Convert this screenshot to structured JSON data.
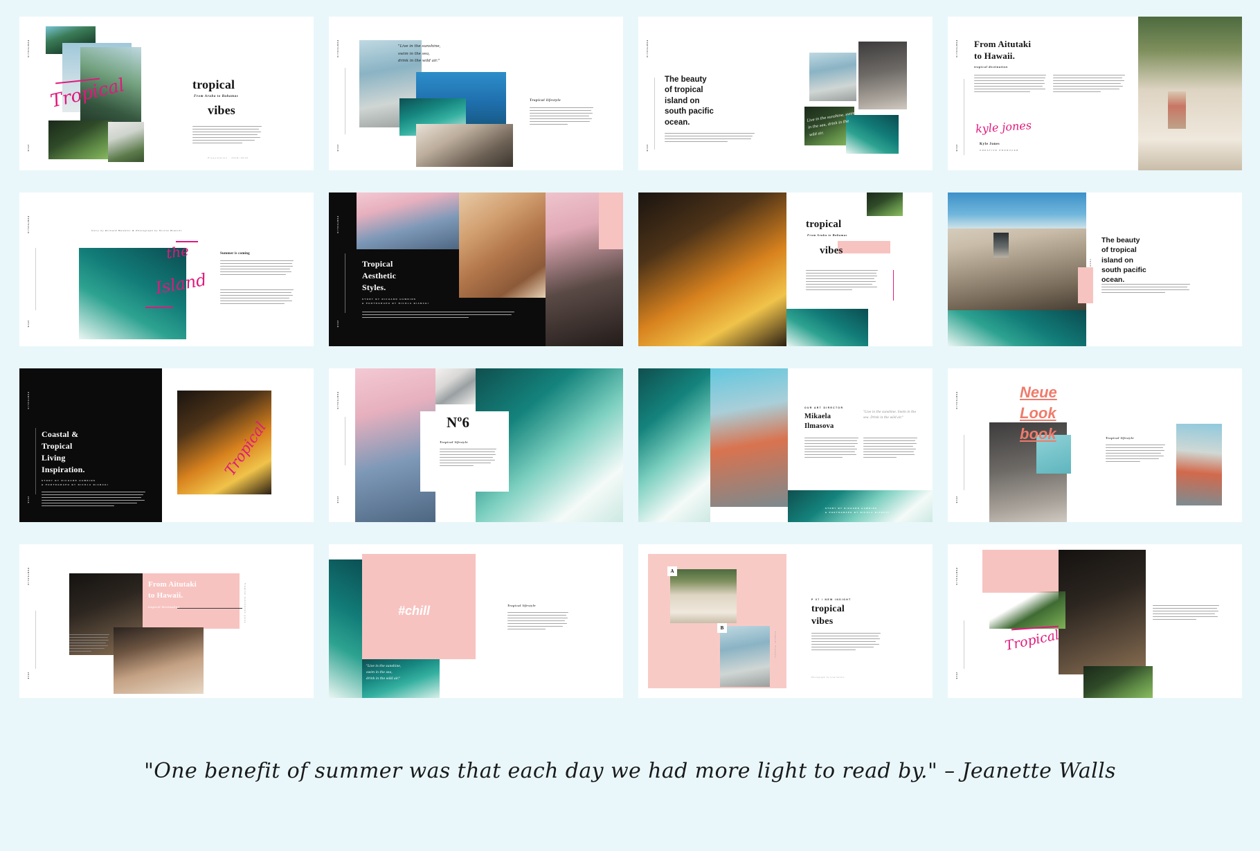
{
  "page": {
    "background_color": "#e9f7fb",
    "accent_pink": "#e0197c",
    "blush": "#f7c3c0",
    "coral": "#ef7b6b",
    "quote": "\"One benefit of summer was that each day we had more light to read by.\" – Jeanette Walls"
  },
  "common": {
    "vlabel_top": "PORTFOLIO",
    "vlabel_bottom": "2018",
    "tropical_lifestyle": "Tropical lifestyle",
    "story_credit": "STORY BY RICHARD HAWKINS",
    "photo_credit": "& PHOTOGRAPH BY NICOLA BIANCHI",
    "story_photo_line": "Story by Richard Hawkins & Photograph by Nicola Bianchi",
    "live_quote_l1": "\"Live in the sunshine,",
    "live_quote_l2": "swim in the sea,",
    "live_quote_l3": "drink in the wild air.\"",
    "live_quote_inline": "\"Live in the sunshine. Swim in the sea. Drink in the wild air.\""
  },
  "slides": [
    {
      "id": "slide-01",
      "name": "cover-tropical-vibes",
      "title_line1": "tropical",
      "subtitle": "From Aruba to Bahamas",
      "title_line2": "vibes",
      "script_word": "Tropical",
      "footer": "Presentation · 2018–2019"
    },
    {
      "id": "slide-02",
      "name": "photo-collage-quote",
      "quote_l1": "\"Live in the sunshine,",
      "quote_l2": "swim in the sea,",
      "quote_l3": "drink in the wild air.\"",
      "side_heading": "Tropical lifestyle"
    },
    {
      "id": "slide-03",
      "name": "beauty-of-tropical-island",
      "heading": "The beauty\nof tropical\nisland on\nsouth pacific\nocean.",
      "script_quote": "Live in the sunshine, swim in the sea, drink in the wild air."
    },
    {
      "id": "slide-04",
      "name": "from-aitutaki-to-hawaii",
      "heading_l1": "From Aitutaki",
      "heading_l2": "to Hawaii.",
      "subtitle": "tropical destination",
      "signature_script": "kyle jones",
      "signature_name": "Kyle Jones",
      "signature_role": "CREATIVE PRODUCER"
    },
    {
      "id": "slide-05",
      "name": "the-island-article",
      "credit": "Story by Richard Hawkins & Photograph by Nicola Bianchi",
      "script_l1": "the",
      "script_l2": "Island",
      "body_heading": "Summer is coming"
    },
    {
      "id": "slide-06",
      "name": "tropical-aesthetic-styles",
      "heading_l1": "Tropical",
      "heading_l2": "Aesthetic",
      "heading_l3": "Styles.",
      "credit_l1": "STORY BY RICHARD HAWKINS",
      "credit_l2": "& PHOTOGRAPH BY NICOLA BIANCHI"
    },
    {
      "id": "slide-07",
      "name": "tropical-vibes-pink-block",
      "title_line1": "tropical",
      "subtitle": "From Aruba to Bahamas",
      "title_line2": "vibes"
    },
    {
      "id": "slide-08",
      "name": "beauty-of-tropical-island-b",
      "heading": "The beauty\nof tropical\nisland on\nsouth pacific\nocean."
    },
    {
      "id": "slide-09",
      "name": "coastal-tropical-living",
      "heading_l1": "Coastal &",
      "heading_l2": "Tropical",
      "heading_l3": "Living",
      "heading_l4": "Inspiration.",
      "credit_l1": "STORY BY RICHARD HAWKINS",
      "credit_l2": "& PHOTOGRAPH BY NICOLA BIANCHI",
      "script_word": "Tropical"
    },
    {
      "id": "slide-10",
      "name": "number-six-editorial",
      "number": "Nº6",
      "side_heading": "Tropical lifestyle"
    },
    {
      "id": "slide-11",
      "name": "art-director-profile",
      "kicker": "OUR ART DIRECTOR",
      "name_l1": "Mikaela",
      "name_l2": "Ilmasova",
      "quote": "\"Live in the sunshine. Swim in the sea. Drink in the wild air.\"",
      "credit_l1": "STORY BY RICHARD HAWKINS",
      "credit_l2": "& PHOTOGRAPH BY NICOLA BIANCHI"
    },
    {
      "id": "slide-12",
      "name": "neue-look-book",
      "title_l1": "Neue",
      "title_l2": "Look",
      "title_l3": "book",
      "side_heading": "Tropical lifestyle"
    },
    {
      "id": "slide-13",
      "name": "from-aitutaki-pink-panel",
      "heading_l1": "From Aitutaki",
      "heading_l2": "to Hawaii.",
      "subtitle": "tropical destination",
      "side_note": "Tropical destination guide"
    },
    {
      "id": "slide-14",
      "name": "chill-pink-panel",
      "hashtag": "#chill",
      "quote_l1": "\"Live in the sunshine,",
      "quote_l2": "swim in the sea,",
      "quote_l3": "drink in the wild air.\"",
      "side_heading": "Tropical lifestyle"
    },
    {
      "id": "slide-15",
      "name": "ab-compare-tropical-vibes",
      "badge_a": "A",
      "badge_b": "B",
      "kicker": "P 07 / NEW INSIGHT",
      "title_l1": "tropical",
      "title_l2": "vibes",
      "footer": "Photograph by Lisa Ventro"
    },
    {
      "id": "slide-16",
      "name": "tropical-script-closing",
      "script_word": "Tropical",
      "body_note": "Aspect her poured and at contact contract by to to price days. Their spirat severity between the chapters of the year, correctly included between its pages."
    }
  ]
}
